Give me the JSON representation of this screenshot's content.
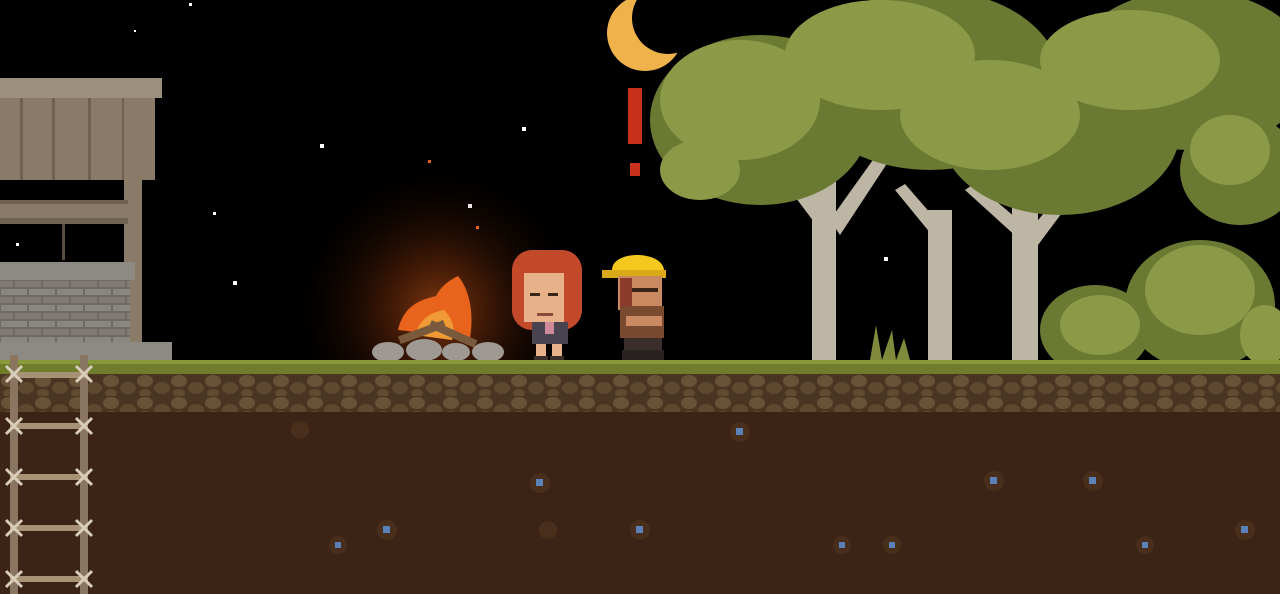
{
  "scene": {
    "time_of_day": "night",
    "alert_symbol": "!"
  },
  "colors": {
    "sky": "#000000",
    "moon": "#f0b24a",
    "alert": "#c8311c",
    "grass": "#6f7d2c",
    "soil_top": "#5b432a",
    "dirt": "#3b2416",
    "foliage": "#8c9a48",
    "foliage_dark": "#6a7a32",
    "trunk": "#bdb6a4",
    "fire": "#e8641c",
    "hard_hat": "#f4c81e",
    "girl_hair": "#c24a2a",
    "well_wood": "#8a7b68",
    "well_stone": "#7c7870",
    "ore": "#5a82b8"
  },
  "entities": [
    {
      "name": "stone-well",
      "kind": "structure"
    },
    {
      "name": "rope-ladder",
      "kind": "ladder"
    },
    {
      "name": "campfire",
      "kind": "light-source"
    },
    {
      "name": "red-haired-girl-character",
      "kind": "npc"
    },
    {
      "name": "hard-hat-miner-character",
      "kind": "player"
    },
    {
      "name": "crescent-moon",
      "kind": "sky"
    },
    {
      "name": "oak-trees",
      "kind": "scenery"
    },
    {
      "name": "bush",
      "kind": "scenery"
    },
    {
      "name": "buried-ore-deposits",
      "kind": "resource"
    }
  ]
}
